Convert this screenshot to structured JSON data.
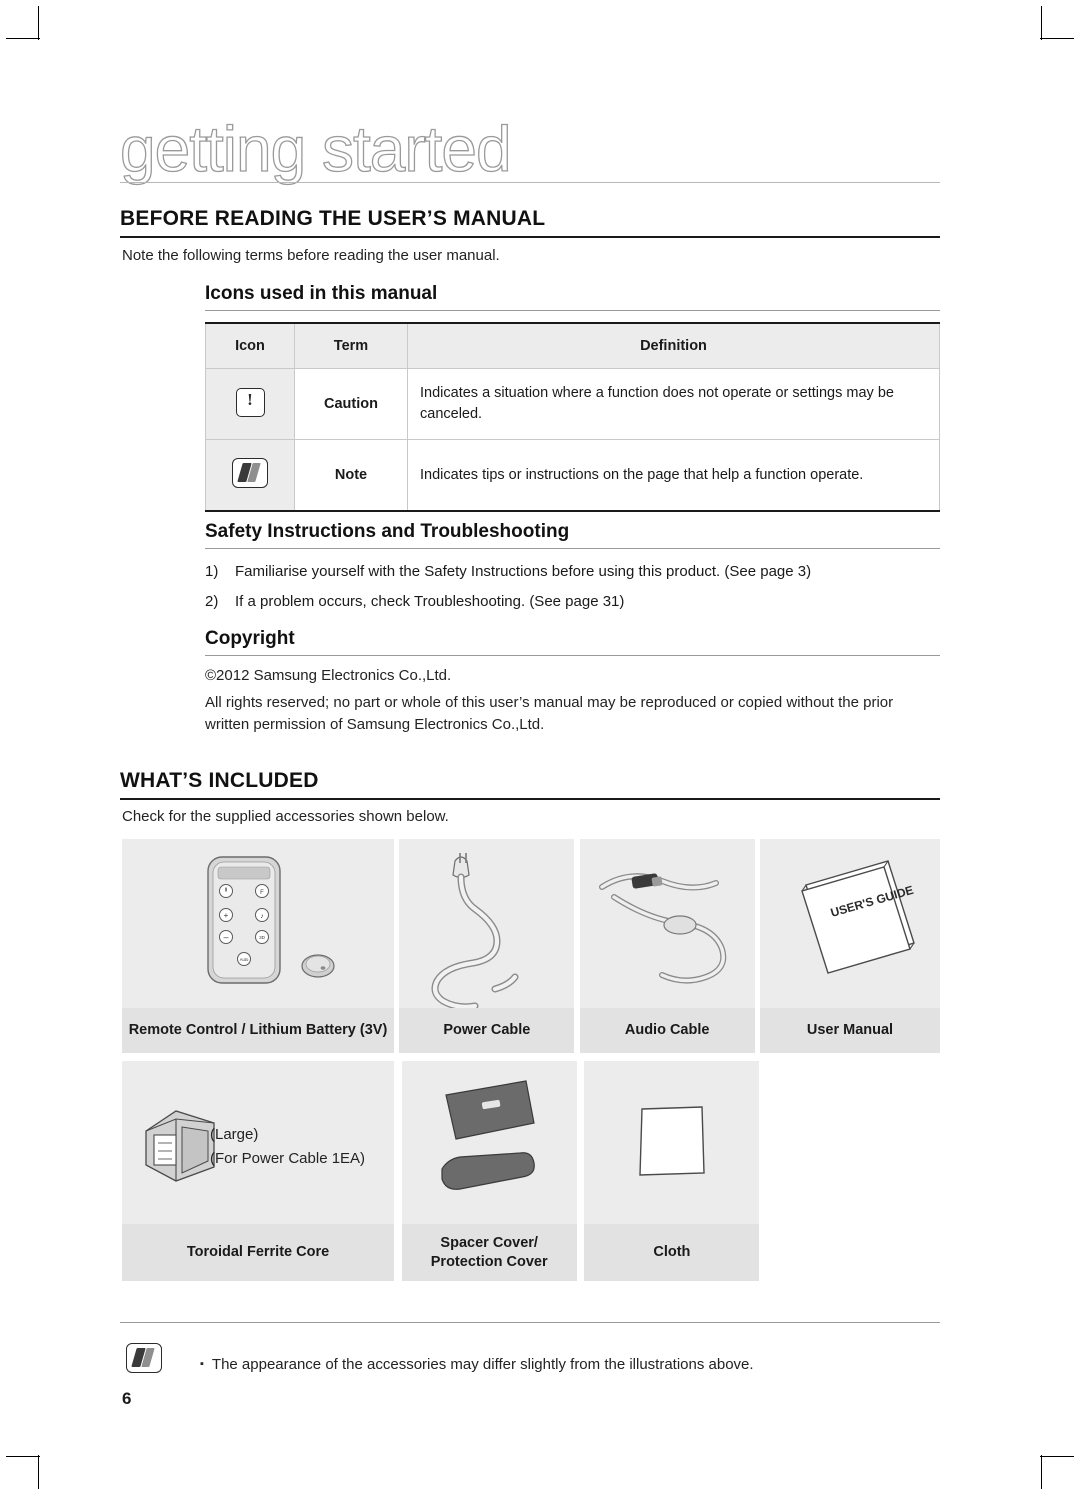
{
  "chapter": {
    "title": "getting started"
  },
  "sections": [
    {
      "heading": "BEFORE READING THE USER’S MANUAL",
      "intro": "Note the following terms before reading the user manual."
    },
    {
      "heading": "WHAT’S INCLUDED",
      "intro": "Check for the supplied accessories shown below."
    }
  ],
  "subsections": {
    "icons_used": "Icons used in this manual",
    "safety": "Safety Instructions and Troubleshooting",
    "copyright": "Copyright"
  },
  "icon_table": {
    "headers": [
      "Icon",
      "Term",
      "Definition"
    ],
    "rows": [
      {
        "icon": "caution-icon",
        "term": "Caution",
        "definition": "Indicates a situation where a function does not operate or settings may be canceled."
      },
      {
        "icon": "note-icon",
        "term": "Note",
        "definition": "Indicates tips or instructions on the page that help a function operate."
      }
    ]
  },
  "safety_list": [
    {
      "num": "1)",
      "text": "Familiarise yourself with the Safety Instructions before using this product. (See page 3)"
    },
    {
      "num": "2)",
      "text": "If a problem occurs, check Troubleshooting. (See page 31)"
    }
  ],
  "copyright": {
    "line1": "©2012 Samsung Electronics Co.,Ltd.",
    "line2": "All rights reserved; no part or whole of this user’s manual may be reproduced or copied without the prior written permission of Samsung Electronics Co.,Ltd."
  },
  "accessories": {
    "row1": [
      {
        "label": "Remote Control / Lithium Battery (3V)",
        "art": "remote-control"
      },
      {
        "label": "Power Cable",
        "art": "power-cable"
      },
      {
        "label": "Audio Cable",
        "art": "audio-cable"
      },
      {
        "label": "User Manual",
        "art": "user-manual",
        "art_text": "USER'S GUIDE"
      }
    ],
    "row2": [
      {
        "label": "Toroidal Ferrite Core",
        "art": "ferrite-core",
        "caption_line1": "(Large)",
        "caption_line2": "(For Power Cable 1EA)"
      },
      {
        "label": "Spacer Cover/\nProtection Cover",
        "label_line1": "Spacer Cover/",
        "label_line2": "Protection Cover",
        "art": "spacer-cover"
      },
      {
        "label": "Cloth",
        "art": "cloth"
      }
    ]
  },
  "footer": {
    "note_bullet": "▪",
    "note": "The appearance of the accessories may differ slightly from the illustrations above.",
    "page_number": "6"
  }
}
